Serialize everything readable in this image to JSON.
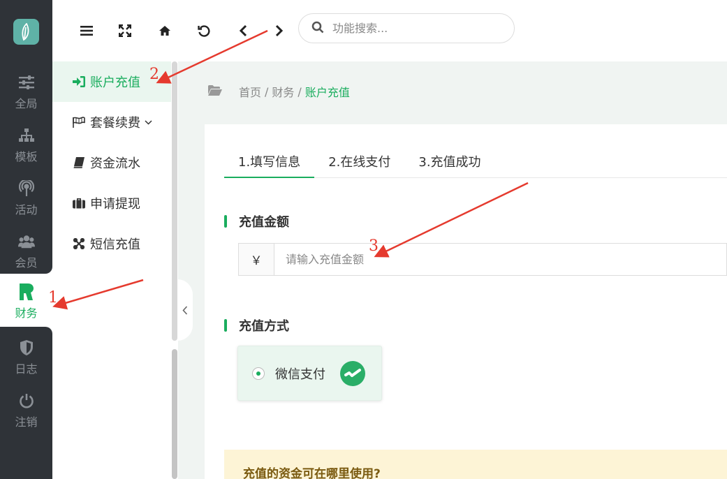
{
  "rail": {
    "items": [
      {
        "label": "全局",
        "icon": "sliders-icon"
      },
      {
        "label": "模板",
        "icon": "sitemap-icon"
      },
      {
        "label": "活动",
        "icon": "broadcast-icon"
      },
      {
        "label": "会员",
        "icon": "users-icon"
      },
      {
        "label": "财务",
        "icon": "finance-icon",
        "active": true
      },
      {
        "label": "日志",
        "icon": "shield-icon"
      },
      {
        "label": "注销",
        "icon": "power-icon"
      }
    ]
  },
  "submenu": {
    "items": [
      {
        "label": "账户充值",
        "icon": "sign-in-icon",
        "active": true
      },
      {
        "label": "套餐续费",
        "icon": "flag-icon",
        "has_caret": true
      },
      {
        "label": "资金流水",
        "icon": "book-icon"
      },
      {
        "label": "申请提现",
        "icon": "briefcase-icon"
      },
      {
        "label": "短信充值",
        "icon": "joomla-icon"
      }
    ]
  },
  "topbar": {
    "search_placeholder": "功能搜索..."
  },
  "breadcrumb": {
    "home": "首页",
    "finance": "财务",
    "current": "账户充值",
    "separator": "/"
  },
  "steps": [
    "1.填写信息",
    "2.在线支付",
    "3.充值成功"
  ],
  "amount": {
    "title": "充值金额",
    "currency": "￥",
    "placeholder": "请输入充值金额"
  },
  "payment": {
    "title": "充值方式",
    "option_label": "微信支付",
    "option_icon": "wechat-pay-icon"
  },
  "notice": {
    "title": "充值的资金可在哪里使用?"
  },
  "annotations": [
    "1",
    "2",
    "3"
  ],
  "colors": {
    "accent": "#1aad5e",
    "rail_bg": "#2f3338",
    "annotation": "#e53a2e"
  }
}
